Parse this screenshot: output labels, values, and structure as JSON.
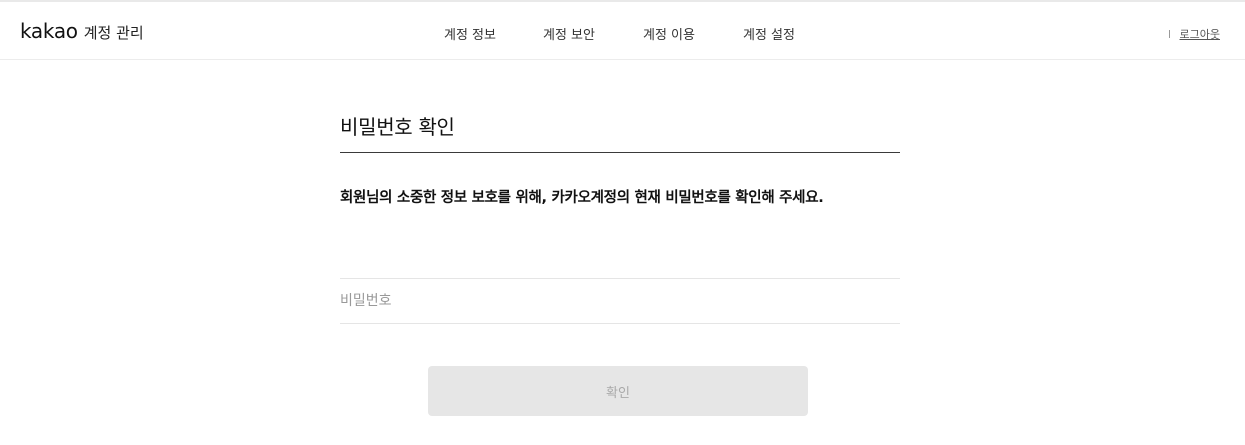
{
  "header": {
    "logo": "kakao",
    "subtitle": "계정 관리",
    "nav": [
      "계정 정보",
      "계정 보안",
      "계정 이용",
      "계정 설정"
    ],
    "logout_label": "로그아웃"
  },
  "main": {
    "title": "비밀번호 확인",
    "description": "회원님의 소중한 정보 보호를 위해, 카카오계정의 현재 비밀번호를 확인해 주세요.",
    "password_placeholder": "비밀번호",
    "password_value": "",
    "confirm_label": "확인",
    "confirm_disabled": true
  },
  "colors": {
    "button_bg": "#e6e6e6",
    "button_text": "#a9a9a9",
    "divider": "#3a3a3a",
    "field_border": "#e5e5e5"
  }
}
